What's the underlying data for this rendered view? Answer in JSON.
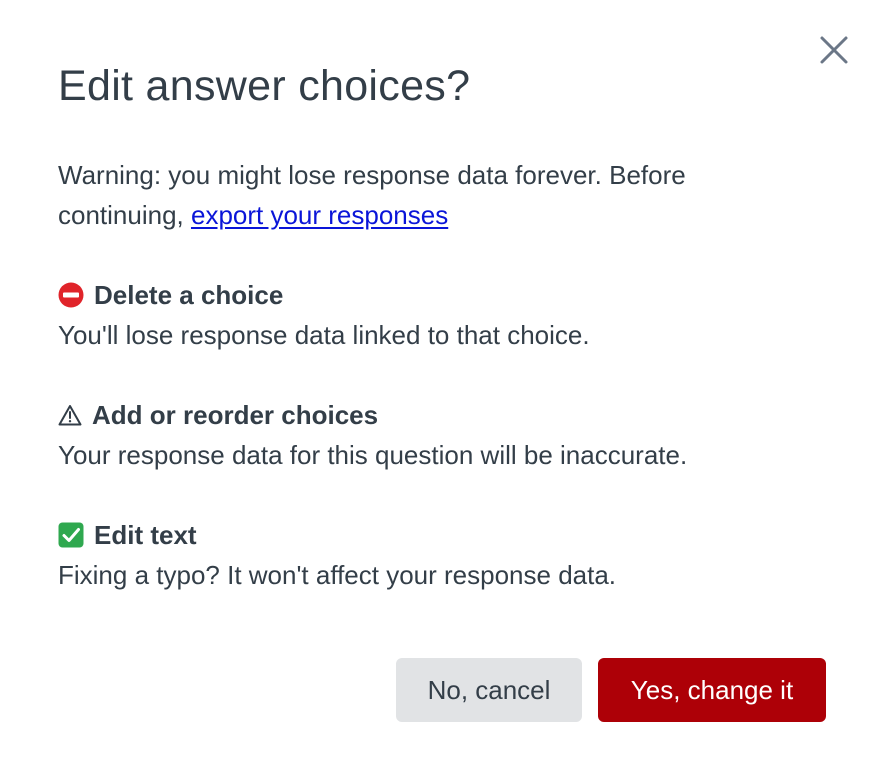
{
  "dialog": {
    "title": "Edit answer choices?",
    "close_label": "×",
    "warning_text": "Warning: you might lose response data forever. Before continuing, ",
    "warning_link": "export your responses",
    "sections": [
      {
        "icon": "no-entry-icon",
        "title": "Delete a choice",
        "description": "You'll lose response data linked to that choice."
      },
      {
        "icon": "warning-icon",
        "title": "Add or reorder choices",
        "description": "Your response data for this question will be inaccurate."
      },
      {
        "icon": "check-mark-icon",
        "title": "Edit text",
        "description": "Fixing a typo? It won't affect your response data."
      }
    ],
    "cancel_label": "No, cancel",
    "confirm_label": "Yes, change it"
  },
  "colors": {
    "confirm_button": "#ad0007",
    "cancel_button": "#e1e3e5",
    "link": "#0a15d8",
    "text": "#333e48",
    "check_icon": "#2fa84f",
    "no_entry_icon": "#e0242a"
  }
}
